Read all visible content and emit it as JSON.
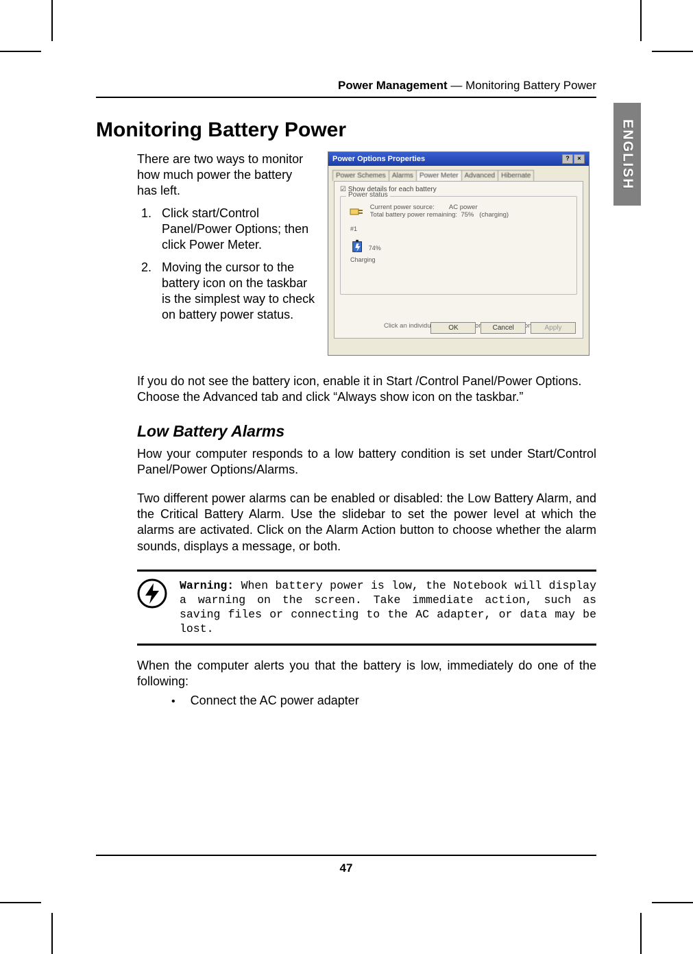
{
  "header": {
    "section": "Power Management",
    "sep": " — ",
    "topic": "Monitoring Battery Power"
  },
  "side_tab": "ENGLISH",
  "h1": "Monitoring Battery Power",
  "intro": "There are two ways to monitor how much power the battery has left.",
  "list1": "Click start/Control Panel/Power Options; then click Power Meter.",
  "list2": "Moving the cursor to the battery icon on the taskbar is the simplest way to check on battery power status.",
  "screenshot": {
    "title": "Power Options Properties",
    "tabs": [
      "Power Schemes",
      "Alarms",
      "Power Meter",
      "Advanced",
      "Hibernate"
    ],
    "checkbox": "Show details for each battery",
    "group_title": "Power status",
    "line1": "Current power source:",
    "line1v": "AC power",
    "line2": "Total battery power remaining:",
    "line2v": "75%",
    "line2s": "(charging)",
    "bat_num": "#1",
    "bat_pct": "74%",
    "bat_state": "Charging",
    "hint": "Click an individual battery icon for more information.",
    "btn_ok": "OK",
    "btn_cancel": "Cancel",
    "btn_apply": "Apply"
  },
  "after_shot": "If you do not see the battery icon, enable it in Start /Control Panel/Power Options. Choose the Advanced tab and click “Always show icon on the taskbar.”",
  "h2": "Low Battery Alarms",
  "p1": "How your computer responds to a low battery condition is set under Start/Control Panel/Power Options/Alarms.",
  "p2": "Two different power alarms can be enabled or disabled: the Low Battery Alarm, and the Critical Battery Alarm. Use the slidebar to set the power level at which the alarms are activated. Click on the Alarm Action button to choose whether the alarm sounds, displays a message, or both.",
  "warning_label": "Warning:",
  "warning_body": " When battery power is low, the Notebook will display a warning on the screen. Take immediate action, such as saving files or connecting to the AC adapter, or data may be lost.",
  "p3": "When the computer alerts you that the battery is low, immediately do one of the following:",
  "bullet1": "Connect the AC power adapter",
  "page_number": "47"
}
